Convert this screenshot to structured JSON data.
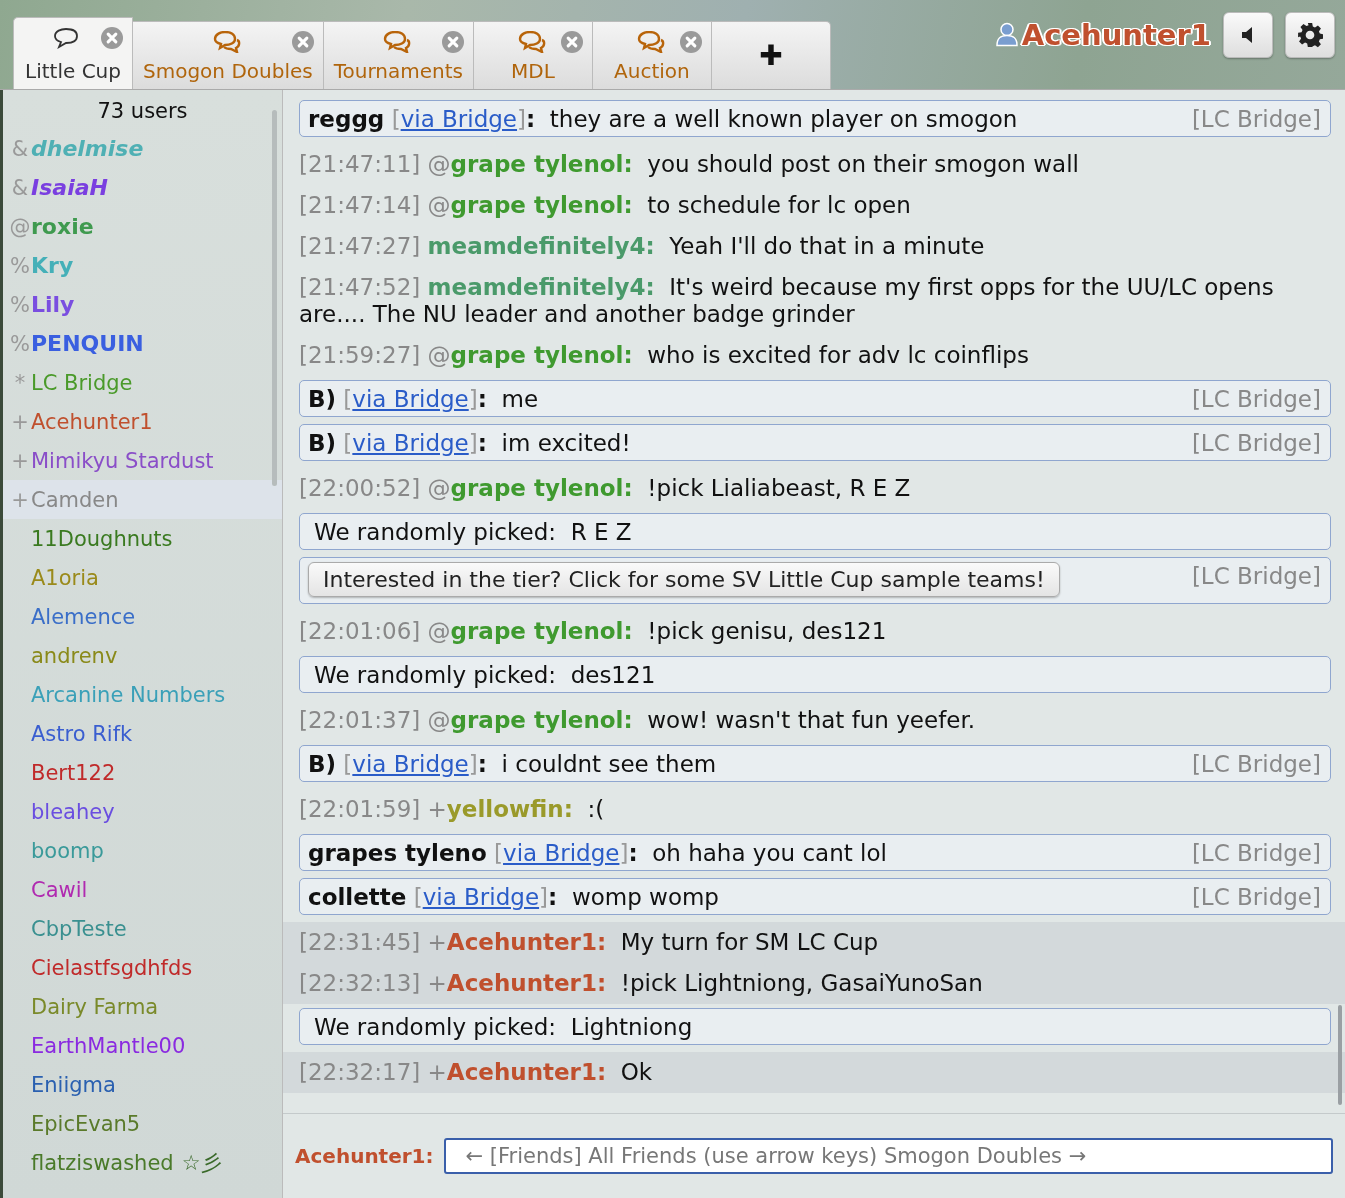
{
  "tabs": [
    {
      "label": "Little Cup",
      "selected": true,
      "unread": false
    },
    {
      "label": "Smogon Doubles",
      "selected": false,
      "unread": true
    },
    {
      "label": "Tournaments",
      "selected": false,
      "unread": true
    },
    {
      "label": "MDL",
      "selected": false,
      "unread": true
    },
    {
      "label": "Auction",
      "selected": false,
      "unread": true
    }
  ],
  "new_tab": "✚",
  "user": {
    "name": "Acehunter1"
  },
  "userlist": {
    "count": "73 users",
    "users": [
      {
        "rank": "&",
        "name": "dhelmise",
        "color": "#4fb0b4",
        "bold": true,
        "italic": true,
        "highlighted": false
      },
      {
        "rank": "&",
        "name": "IsaiaH",
        "color": "#7a3fe0",
        "bold": true,
        "italic": true,
        "highlighted": false
      },
      {
        "rank": "@",
        "name": "roxie",
        "color": "#3f9a4f",
        "bold": true,
        "italic": false,
        "highlighted": false
      },
      {
        "rank": "%",
        "name": "Kry",
        "color": "#45b0b8",
        "bold": true,
        "italic": false,
        "highlighted": false
      },
      {
        "rank": "%",
        "name": "Lily",
        "color": "#7a4ee0",
        "bold": true,
        "italic": false,
        "highlighted": false
      },
      {
        "rank": "%",
        "name": "PENQUIN",
        "color": "#3a5fe0",
        "bold": true,
        "italic": false,
        "highlighted": false
      },
      {
        "rank": "*",
        "name": "LC Bridge",
        "color": "#4a9a2a",
        "bold": false,
        "italic": false,
        "highlighted": false
      },
      {
        "rank": "+",
        "name": "Acehunter1",
        "color": "#c0502e",
        "bold": false,
        "italic": false,
        "highlighted": false
      },
      {
        "rank": "+",
        "name": "Mimikyu Stardust",
        "color": "#8a4ec8",
        "bold": false,
        "italic": false,
        "highlighted": false
      },
      {
        "rank": "+",
        "name": "Camden",
        "color": "#888888",
        "bold": false,
        "italic": false,
        "highlighted": true
      },
      {
        "name": "11Doughnuts",
        "color": "#3a7a20",
        "bold": false,
        "italic": false,
        "highlighted": false
      },
      {
        "name": "A1oria",
        "color": "#9a8a1a",
        "bold": false,
        "italic": false,
        "highlighted": false
      },
      {
        "name": "Alemence",
        "color": "#3a6ec8",
        "bold": false,
        "italic": false,
        "highlighted": false
      },
      {
        "name": "andrenv",
        "color": "#8a8a1a",
        "bold": false,
        "italic": false,
        "highlighted": false
      },
      {
        "name": "Arcanine Numbers",
        "color": "#3aa0b8",
        "bold": false,
        "italic": false,
        "highlighted": false
      },
      {
        "name": "Astro Rifk",
        "color": "#3a5ed0",
        "bold": false,
        "italic": false,
        "highlighted": false
      },
      {
        "name": "Bert122",
        "color": "#c02a2a",
        "bold": false,
        "italic": false,
        "highlighted": false
      },
      {
        "name": "bleahey",
        "color": "#6a4ee0",
        "bold": false,
        "italic": false,
        "highlighted": false
      },
      {
        "name": "boomp",
        "color": "#3a9a9a",
        "bold": false,
        "italic": false,
        "highlighted": false
      },
      {
        "name": "Cawil",
        "color": "#b02ab0",
        "bold": false,
        "italic": false,
        "highlighted": false
      },
      {
        "name": "CbpTeste",
        "color": "#3a9090",
        "bold": false,
        "italic": false,
        "highlighted": false
      },
      {
        "name": "Cielastfsgdhfds",
        "color": "#c02a2a",
        "bold": false,
        "italic": false,
        "highlighted": false
      },
      {
        "name": "Dairy Farma",
        "color": "#7a8a2a",
        "bold": false,
        "italic": false,
        "highlighted": false
      },
      {
        "name": "EarthMantle00",
        "color": "#8a2ae0",
        "bold": false,
        "italic": false,
        "highlighted": false
      },
      {
        "name": "Eniigma",
        "color": "#2a60b0",
        "bold": false,
        "italic": false,
        "highlighted": false
      },
      {
        "name": "EpicEvan5",
        "color": "#5a7a2a",
        "bold": false,
        "italic": false,
        "highlighted": false
      },
      {
        "name": "flatziswashed",
        "color": "#4a7a2a",
        "bold": false,
        "italic": false,
        "highlighted": false,
        "badge": "☆彡"
      }
    ]
  },
  "messages": [
    {
      "kind": "bridge",
      "name": "reggg",
      "open": "[",
      "via": "via Bridge",
      "close": "]",
      "colon": ":",
      "text": "they are a well known player on smogon",
      "tag": "[LC Bridge]"
    },
    {
      "kind": "chat",
      "time": "[21:47:11]",
      "rank": "@",
      "name": "grape tylenol:",
      "color": "#3f9a2f",
      "text": "you should post on their smogon wall",
      "highlighted": false
    },
    {
      "kind": "chat",
      "time": "[21:47:14]",
      "rank": "@",
      "name": "grape tylenol:",
      "color": "#3f9a2f",
      "text": "to schedule for lc open",
      "highlighted": false
    },
    {
      "kind": "chat",
      "time": "[21:47:27]",
      "name": "meamdefinitely4:",
      "color": "#4a9a6a",
      "text": "Yeah I'll do that in a minute",
      "highlighted": false
    },
    {
      "kind": "chat",
      "time": "[21:47:52]",
      "name": "meamdefinitely4:",
      "color": "#4a9a6a",
      "text": "It's weird because my first opps for the UU/LC opens are.... The NU leader and another badge grinder",
      "highlighted": false
    },
    {
      "kind": "chat",
      "time": "[21:59:27]",
      "rank": "@",
      "name": "grape tylenol:",
      "color": "#3f9a2f",
      "text": "who is excited for adv lc coinflips",
      "highlighted": false
    },
    {
      "kind": "bridge",
      "name": "B)",
      "open": "[",
      "via": "via Bridge",
      "close": "]",
      "colon": ":",
      "text": "me",
      "tag": "[LC Bridge]"
    },
    {
      "kind": "bridge",
      "name": "B)",
      "open": "[",
      "via": "via Bridge",
      "close": "]",
      "colon": ":",
      "text": "im excited!",
      "tag": "[LC Bridge]"
    },
    {
      "kind": "chat",
      "time": "[22:00:52]",
      "rank": "@",
      "name": "grape tylenol:",
      "color": "#3f9a2f",
      "text": "!pick Lialiabeast, R E Z",
      "highlighted": false
    },
    {
      "kind": "notice",
      "text": "We randomly picked:",
      "value": "R E Z"
    },
    {
      "kind": "button",
      "label": "Interested in the tier? Click for some SV Little Cup sample teams!",
      "tag": "[LC Bridge]"
    },
    {
      "kind": "chat",
      "time": "[22:01:06]",
      "rank": "@",
      "name": "grape tylenol:",
      "color": "#3f9a2f",
      "text": "!pick genisu, des121",
      "highlighted": false
    },
    {
      "kind": "notice",
      "text": "We randomly picked:",
      "value": "des121"
    },
    {
      "kind": "chat",
      "time": "[22:01:37]",
      "rank": "@",
      "name": "grape tylenol:",
      "color": "#3f9a2f",
      "text": "wow! wasn't that fun yeefer.",
      "highlighted": false
    },
    {
      "kind": "bridge",
      "name": "B)",
      "open": "[",
      "via": "via Bridge",
      "close": "]",
      "colon": ":",
      "text": "i couldnt see them",
      "tag": "[LC Bridge]"
    },
    {
      "kind": "chat",
      "time": "[22:01:59]",
      "rank": "+",
      "name": "yellowfin:",
      "color": "#9a9a2a",
      "text": ":(",
      "highlighted": false
    },
    {
      "kind": "bridge",
      "name": "grapes tyleno",
      "open": "[",
      "via": "via Bridge",
      "close": "]",
      "colon": ":",
      "text": "oh haha you cant lol",
      "tag": "[LC Bridge]"
    },
    {
      "kind": "bridge",
      "name": "collette",
      "open": "[",
      "via": "via Bridge",
      "close": "]",
      "colon": ":",
      "text": "womp womp",
      "tag": "[LC Bridge]"
    },
    {
      "kind": "chat",
      "time": "[22:31:45]",
      "rank": "+",
      "name": "Acehunter1:",
      "color": "#c0502e",
      "text": "My turn for SM LC Cup",
      "highlighted": true
    },
    {
      "kind": "chat",
      "time": "[22:32:13]",
      "rank": "+",
      "name": "Acehunter1:",
      "color": "#c0502e",
      "text": "!pick Lightniong, GasaiYunoSan",
      "highlighted": true
    },
    {
      "kind": "notice",
      "text": "We randomly picked:",
      "value": "Lightniong"
    },
    {
      "kind": "chat",
      "time": "[22:32:17]",
      "rank": "+",
      "name": "Acehunter1:",
      "color": "#c0502e",
      "text": "Ok",
      "highlighted": true
    }
  ],
  "composer": {
    "label": "Acehunter1:",
    "placeholder": "← [Friends] All Friends (use arrow keys) Smogon Doubles →"
  }
}
